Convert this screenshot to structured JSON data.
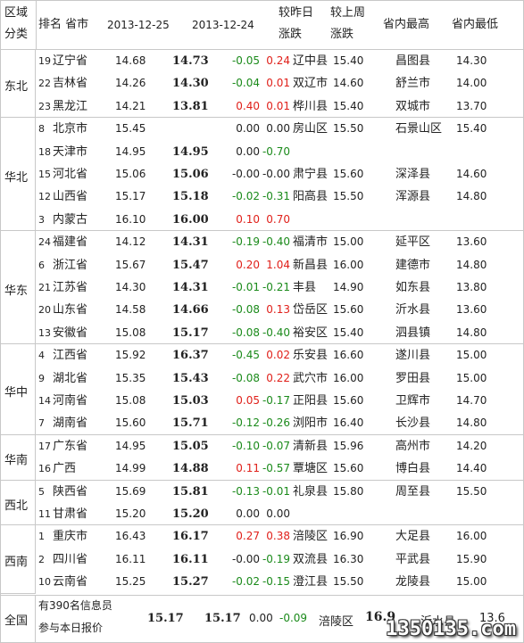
{
  "header": {
    "region_l1": "区域",
    "region_l2": "分类",
    "rank_province": "排名  省市",
    "date1": "2013-12-25",
    "date2": "2013-12-24",
    "vs_yday_l1": "较昨日",
    "vs_yday_l2": "涨跌",
    "vs_week_l1": "较上周",
    "vs_week_l2": "涨跌",
    "prov_high": "省内最高",
    "prov_low": "省内最低"
  },
  "regions": [
    {
      "name": "东北",
      "rows": [
        {
          "rank": "19",
          "province": "辽宁省",
          "price_a": "14.68",
          "price_b": "14.73",
          "change_day": "-0.05",
          "change_week": "0.24",
          "city_high": "辽中县",
          "high": "15.40",
          "city_low": "昌图县",
          "low": "14.30"
        },
        {
          "rank": "22",
          "province": "吉林省",
          "price_a": "14.26",
          "price_b": "14.30",
          "change_day": "-0.04",
          "change_week": "0.01",
          "city_high": "双辽市",
          "high": "14.60",
          "city_low": "舒兰市",
          "low": "14.00"
        },
        {
          "rank": "23",
          "province": "黑龙江",
          "price_a": "14.21",
          "price_b": "13.81",
          "change_day": "0.40",
          "change_week": "0.01",
          "city_high": "桦川县",
          "high": "15.40",
          "city_low": "双城市",
          "low": "13.70"
        }
      ]
    },
    {
      "name": "华北",
      "rows": [
        {
          "rank": "8",
          "province": "北京市",
          "price_a": "15.45",
          "price_b": "",
          "change_day": "0.00",
          "change_week": "0.00",
          "city_high": "房山区",
          "high": "15.50",
          "city_low": "石景山区",
          "low": "15.40"
        },
        {
          "rank": "18",
          "province": "天津市",
          "price_a": "14.95",
          "price_b": "14.95",
          "change_day": "0.00",
          "change_week": "-0.70",
          "city_high": "",
          "high": "",
          "city_low": "",
          "low": ""
        },
        {
          "rank": "15",
          "province": "河北省",
          "price_a": "15.06",
          "price_b": "15.06",
          "change_day": "-0.00",
          "change_week": "-0.00",
          "city_high": "肃宁县",
          "high": "15.60",
          "city_low": "深泽县",
          "low": "14.60"
        },
        {
          "rank": "12",
          "province": "山西省",
          "price_a": "15.17",
          "price_b": "15.18",
          "change_day": "-0.02",
          "change_week": "-0.31",
          "city_high": "阳高县",
          "high": "15.50",
          "city_low": "浑源县",
          "low": "14.80"
        },
        {
          "rank": "3",
          "province": "内蒙古",
          "price_a": "16.10",
          "price_b": "16.00",
          "change_day": "0.10",
          "change_week": "0.70",
          "city_high": "",
          "high": "",
          "city_low": "",
          "low": ""
        }
      ]
    },
    {
      "name": "华东",
      "rows": [
        {
          "rank": "24",
          "province": "福建省",
          "price_a": "14.12",
          "price_b": "14.31",
          "change_day": "-0.19",
          "change_week": "-0.40",
          "city_high": "福清市",
          "high": "15.00",
          "city_low": "延平区",
          "low": "13.60"
        },
        {
          "rank": "6",
          "province": "浙江省",
          "price_a": "15.67",
          "price_b": "15.47",
          "change_day": "0.20",
          "change_week": "1.04",
          "city_high": "新昌县",
          "high": "16.00",
          "city_low": "建德市",
          "low": "14.80"
        },
        {
          "rank": "21",
          "province": "江苏省",
          "price_a": "14.30",
          "price_b": "14.31",
          "change_day": "-0.01",
          "change_week": "-0.21",
          "city_high": "丰县",
          "high": "14.90",
          "city_low": "如东县",
          "low": "13.80"
        },
        {
          "rank": "20",
          "province": "山东省",
          "price_a": "14.58",
          "price_b": "14.66",
          "change_day": "-0.08",
          "change_week": "0.13",
          "city_high": "岱岳区",
          "high": "15.60",
          "city_low": "沂水县",
          "low": "13.60"
        },
        {
          "rank": "13",
          "province": "安徽省",
          "price_a": "15.08",
          "price_b": "15.17",
          "change_day": "-0.08",
          "change_week": "-0.40",
          "city_high": "裕安区",
          "high": "15.40",
          "city_low": "泗县镇",
          "low": "14.80"
        }
      ]
    },
    {
      "name": "华中",
      "rows": [
        {
          "rank": "4",
          "province": "江西省",
          "price_a": "15.92",
          "price_b": "16.37",
          "change_day": "-0.45",
          "change_week": "0.02",
          "city_high": "乐安县",
          "high": "16.60",
          "city_low": "遂川县",
          "low": "15.00"
        },
        {
          "rank": "9",
          "province": "湖北省",
          "price_a": "15.35",
          "price_b": "15.43",
          "change_day": "-0.08",
          "change_week": "0.22",
          "city_high": "武穴市",
          "high": "16.00",
          "city_low": "罗田县",
          "low": "15.00"
        },
        {
          "rank": "14",
          "province": "河南省",
          "price_a": "15.08",
          "price_b": "15.03",
          "change_day": "0.05",
          "change_week": "-0.17",
          "city_high": "正阳县",
          "high": "15.60",
          "city_low": "卫辉市",
          "low": "14.70"
        },
        {
          "rank": "7",
          "province": "湖南省",
          "price_a": "15.60",
          "price_b": "15.71",
          "change_day": "-0.12",
          "change_week": "-0.26",
          "city_high": "浏阳市",
          "high": "16.40",
          "city_low": "长沙县",
          "low": "14.80"
        }
      ]
    },
    {
      "name": "华南",
      "rows": [
        {
          "rank": "17",
          "province": "广东省",
          "price_a": "14.95",
          "price_b": "15.05",
          "change_day": "-0.10",
          "change_week": "-0.07",
          "city_high": "清新县",
          "high": "15.96",
          "city_low": "高州市",
          "low": "14.20"
        },
        {
          "rank": "16",
          "province": "广西",
          "price_a": "14.99",
          "price_b": "14.88",
          "change_day": "0.11",
          "change_week": "-0.57",
          "city_high": "覃塘区",
          "high": "15.60",
          "city_low": "博白县",
          "low": "14.40"
        }
      ]
    },
    {
      "name": "西北",
      "rows": [
        {
          "rank": "5",
          "province": "陕西省",
          "price_a": "15.69",
          "price_b": "15.81",
          "change_day": "-0.13",
          "change_week": "-0.01",
          "city_high": "礼泉县",
          "high": "15.80",
          "city_low": "周至县",
          "low": "15.50"
        },
        {
          "rank": "11",
          "province": "甘肃省",
          "price_a": "15.20",
          "price_b": "15.20",
          "change_day": "0.00",
          "change_week": "0.00",
          "city_high": "",
          "high": "",
          "city_low": "",
          "low": ""
        }
      ]
    },
    {
      "name": "西南",
      "rows": [
        {
          "rank": "1",
          "province": "重庆市",
          "price_a": "16.43",
          "price_b": "16.17",
          "change_day": "0.27",
          "change_week": "0.38",
          "city_high": "涪陵区",
          "high": "16.90",
          "city_low": "大足县",
          "low": "16.00"
        },
        {
          "rank": "2",
          "province": "四川省",
          "price_a": "16.11",
          "price_b": "16.11",
          "change_day": "-0.00",
          "change_week": "-0.19",
          "city_high": "双流县",
          "high": "16.30",
          "city_low": "平武县",
          "low": "15.90"
        },
        {
          "rank": "10",
          "province": "云南省",
          "price_a": "15.25",
          "price_b": "15.27",
          "change_day": "-0.02",
          "change_week": "-0.15",
          "city_high": "澄江县",
          "high": "15.50",
          "city_low": "龙陵县",
          "low": "15.00"
        }
      ]
    }
  ],
  "national": {
    "name": "全国",
    "note_l1": "有390名信息员",
    "note_l2": "参与本日报价",
    "price_a": "15.17",
    "price_b": "15.17",
    "change_day": "0.00",
    "change_week": "-0.09",
    "city_high": "涪陵区",
    "high": "16.9",
    "city_low": "沂水县",
    "low": "13.6"
  },
  "watermark": "1350135.com",
  "colors": {
    "up": "#e0201a",
    "down": "#1a8a1a",
    "border": "#c8c8c8"
  }
}
